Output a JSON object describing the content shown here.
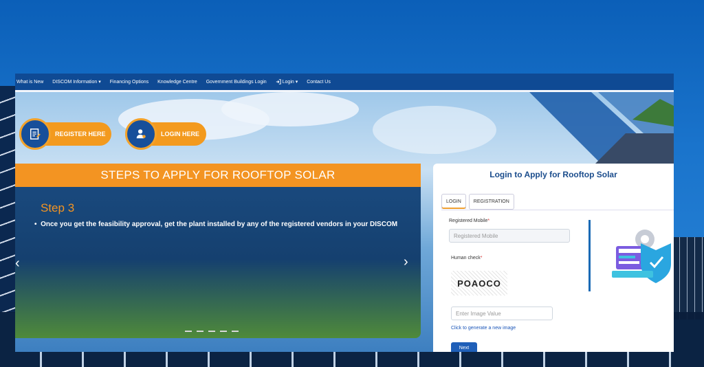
{
  "nav": {
    "items": [
      "What is New",
      "DISCOM Information ▾",
      "Financing Options",
      "Knowledge Centre",
      "Government Buildings Login",
      "Login ▾",
      "Contact Us"
    ]
  },
  "hero": {
    "register_label": "REGISTER HERE",
    "login_label": "LOGIN HERE"
  },
  "steps": {
    "heading": "STEPS TO APPLY FOR ROOFTOP SOLAR",
    "step_title": "Step 3",
    "step_text": "Once you get the feasibility approval, get the plant installed by any of the registered vendors in your DISCOM"
  },
  "login": {
    "title": "Login to Apply for Rooftop Solar",
    "tabs": [
      "LOGIN",
      "REGISTRATION"
    ],
    "mobile_label": "Registered Mobile",
    "mobile_placeholder": "Registered Mobile",
    "human_label": "Human check",
    "captcha_text": "POAOCO",
    "image_placeholder": "Enter Image Value",
    "regen_link": "Click to generate a new image",
    "submit_label": "Next",
    "required_mark": "*"
  },
  "colors": {
    "accent": "#f39422",
    "nav": "#0f4a94",
    "brand": "#1a4c8c"
  },
  "icons": [
    "form-icon",
    "user-icon",
    "login-arrow-icon",
    "chevron-left-icon",
    "chevron-right-icon"
  ]
}
